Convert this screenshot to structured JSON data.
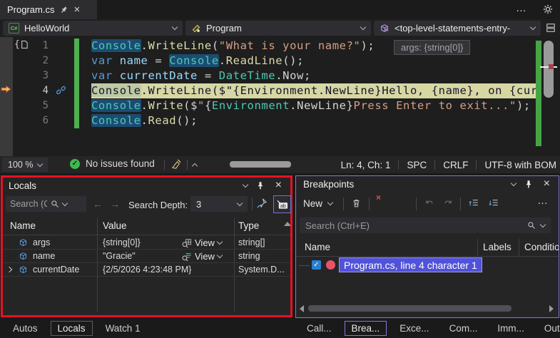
{
  "tab_bar": {
    "title": "Program.cs",
    "more": "…"
  },
  "nav_bar": {
    "project": "HelloWorld",
    "type_name": "Program",
    "member": "<top-level-statements-entry-"
  },
  "editor": {
    "datatip": "args: {string[0]}",
    "lines": [
      {
        "num": "1",
        "segments": [
          {
            "t": "type",
            "s": "Console",
            "hl": true
          },
          {
            "t": "punc",
            "s": "."
          },
          {
            "t": "method",
            "s": "WriteLine"
          },
          {
            "t": "punc",
            "s": "("
          },
          {
            "t": "string",
            "s": "\"What is your name?\""
          },
          {
            "t": "punc",
            "s": ");"
          }
        ]
      },
      {
        "num": "2",
        "segments": [
          {
            "t": "kw",
            "s": "var"
          },
          {
            "t": "punc",
            "s": " "
          },
          {
            "t": "local",
            "s": "name"
          },
          {
            "t": "punc",
            "s": " = "
          },
          {
            "t": "type",
            "s": "Console",
            "hl": true
          },
          {
            "t": "punc",
            "s": "."
          },
          {
            "t": "method",
            "s": "ReadLine"
          },
          {
            "t": "punc",
            "s": "();"
          }
        ]
      },
      {
        "num": "3",
        "segments": [
          {
            "t": "kw",
            "s": "var"
          },
          {
            "t": "punc",
            "s": " "
          },
          {
            "t": "local",
            "s": "currentDate"
          },
          {
            "t": "punc",
            "s": " = "
          },
          {
            "t": "type",
            "s": "DateTime"
          },
          {
            "t": "punc",
            "s": ".Now;"
          }
        ]
      },
      {
        "num": "4",
        "current": true,
        "segments": [
          {
            "t": "dark",
            "s": "Console",
            "hl4": true
          },
          {
            "t": "dark",
            "s": ".WriteLine($\"{Environment.NewLine}Hello, {name}, on {cur"
          }
        ]
      },
      {
        "num": "5",
        "segments": [
          {
            "t": "type",
            "s": "Console",
            "hl": true
          },
          {
            "t": "punc",
            "s": "."
          },
          {
            "t": "method",
            "s": "Write"
          },
          {
            "t": "punc",
            "s": "($"
          },
          {
            "t": "string",
            "s": "\""
          },
          {
            "t": "punc",
            "s": "{"
          },
          {
            "t": "type",
            "s": "Environment"
          },
          {
            "t": "punc",
            "s": ".NewLine}"
          },
          {
            "t": "string",
            "s": "Press Enter to exit...\""
          },
          {
            "t": "punc",
            "s": ");"
          }
        ]
      },
      {
        "num": "6",
        "segments": [
          {
            "t": "type",
            "s": "Console",
            "hl": true
          },
          {
            "t": "punc",
            "s": "."
          },
          {
            "t": "method",
            "s": "Read"
          },
          {
            "t": "punc",
            "s": "();"
          }
        ]
      }
    ]
  },
  "status_bar": {
    "zoom": "100 %",
    "issues": "No issues found",
    "position": "Ln: 4, Ch: 1",
    "spaces": "SPC",
    "eol": "CRLF",
    "encoding": "UTF-8 with BOM"
  },
  "locals": {
    "title": "Locals",
    "search_placeholder": "Search (Ctrl+E)",
    "depth_label": "Search Depth:",
    "depth_value": "3",
    "columns": [
      "Name",
      "Value",
      "Type"
    ],
    "rows": [
      {
        "name": "args",
        "value": "{string[0]}",
        "view": "View",
        "view_icon": "grid",
        "type": "string[]",
        "expandable": false
      },
      {
        "name": "name",
        "value": "\"Gracie\"",
        "view": "View",
        "view_icon": "text",
        "type": "string",
        "expandable": false
      },
      {
        "name": "currentDate",
        "value": "{2/5/2026 4:23:48 PM}",
        "view": null,
        "view_icon": null,
        "type": "System.D...",
        "expandable": true
      }
    ],
    "tabs": [
      "Autos",
      "Locals",
      "Watch 1"
    ],
    "active_tab": "Locals"
  },
  "breakpoints": {
    "title": "Breakpoints",
    "new_label": "New",
    "search_placeholder": "Search (Ctrl+E)",
    "columns": [
      "Name",
      "Labels",
      "Condition"
    ],
    "rows": [
      {
        "label": "Program.cs, line 4 character 1",
        "checked": true
      }
    ],
    "tabs": [
      "Call...",
      "Brea...",
      "Exce...",
      "Com...",
      "Imm...",
      "Output"
    ],
    "active_tab": "Brea..."
  },
  "colors": {
    "locals_highlight_border": "#e81123",
    "focused_window_border": "#8579d6",
    "current_line_background": "#d7d7a3",
    "change_tracking_green": "#4fae4f",
    "breakpoint_red": "#ea5167",
    "selection_blue": "#5152d9"
  }
}
